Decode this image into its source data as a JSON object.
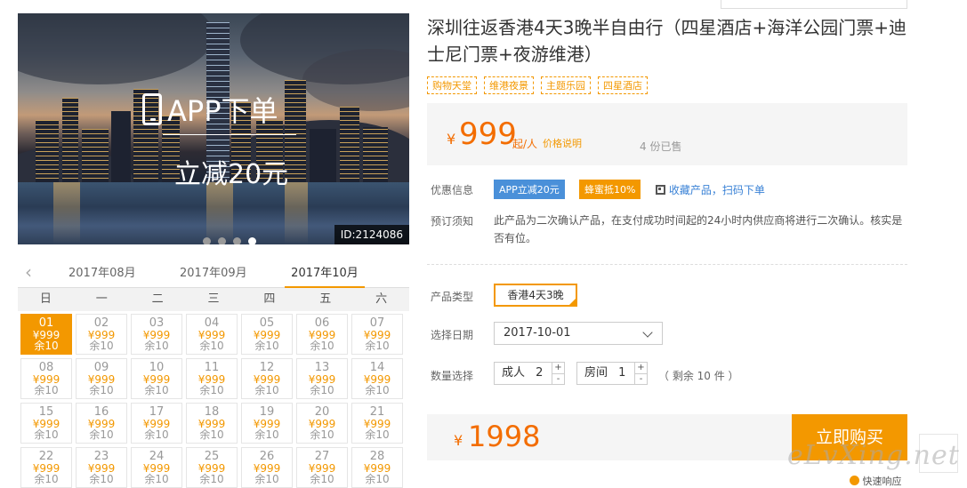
{
  "hero": {
    "promo_line1": "APP下单",
    "promo_line2": "立减20元",
    "id_tag": "ID:2124086",
    "carousel_count": 4,
    "carousel_active": 4
  },
  "calendar": {
    "months": [
      "2017年08月",
      "2017年09月",
      "2017年10月"
    ],
    "active_month": "2017年10月",
    "weekdays": [
      "日",
      "一",
      "二",
      "三",
      "四",
      "五",
      "六"
    ],
    "days": [
      {
        "day": "01",
        "price": "¥999",
        "stock": "余10",
        "selected": true
      },
      {
        "day": "02",
        "price": "¥999",
        "stock": "余10"
      },
      {
        "day": "03",
        "price": "¥999",
        "stock": "余10"
      },
      {
        "day": "04",
        "price": "¥999",
        "stock": "余10"
      },
      {
        "day": "05",
        "price": "¥999",
        "stock": "余10"
      },
      {
        "day": "06",
        "price": "¥999",
        "stock": "余10"
      },
      {
        "day": "07",
        "price": "¥999",
        "stock": "余10"
      },
      {
        "day": "08",
        "price": "¥999",
        "stock": "余10"
      },
      {
        "day": "09",
        "price": "¥999",
        "stock": "余10"
      },
      {
        "day": "10",
        "price": "¥999",
        "stock": "余10"
      },
      {
        "day": "11",
        "price": "¥999",
        "stock": "余10"
      },
      {
        "day": "12",
        "price": "¥999",
        "stock": "余10"
      },
      {
        "day": "13",
        "price": "¥999",
        "stock": "余10"
      },
      {
        "day": "14",
        "price": "¥999",
        "stock": "余10"
      },
      {
        "day": "15",
        "price": "¥999",
        "stock": "余10"
      },
      {
        "day": "16",
        "price": "¥999",
        "stock": "余10"
      },
      {
        "day": "17",
        "price": "¥999",
        "stock": "余10"
      },
      {
        "day": "18",
        "price": "¥999",
        "stock": "余10"
      },
      {
        "day": "19",
        "price": "¥999",
        "stock": "余10"
      },
      {
        "day": "20",
        "price": "¥999",
        "stock": "余10"
      },
      {
        "day": "21",
        "price": "¥999",
        "stock": "余10"
      },
      {
        "day": "22",
        "price": "¥999",
        "stock": "余10"
      },
      {
        "day": "23",
        "price": "¥999",
        "stock": "余10"
      },
      {
        "day": "24",
        "price": "¥999",
        "stock": "余10"
      },
      {
        "day": "25",
        "price": "¥999",
        "stock": "余10"
      },
      {
        "day": "26",
        "price": "¥999",
        "stock": "余10"
      },
      {
        "day": "27",
        "price": "¥999",
        "stock": "余10"
      },
      {
        "day": "28",
        "price": "¥999",
        "stock": "余10"
      }
    ]
  },
  "product": {
    "title": "深圳往返香港4天3晚半自由行（四星酒店+海洋公园门票+迪士尼门票+夜游维港）",
    "tags": [
      "购物天堂",
      "维港夜景",
      "主题乐园",
      "四星酒店"
    ],
    "currency": "¥",
    "price": "999",
    "price_unit": "起/人",
    "price_note": "价格说明",
    "sold": "4 份已售",
    "offers_label": "优惠信息",
    "offer_app": "APP立减20元",
    "offer_honey": "蜂蜜抵10%",
    "favorite_link": "收藏产品，扫码下单",
    "booking_label": "预订须知",
    "booking_text": "此产品为二次确认产品，在支付成功时间起的24小时内供应商将进行二次确认。核实是否有位。",
    "type_label": "产品类型",
    "type_value": "香港4天3晚",
    "date_label": "选择日期",
    "date_value": "2017-10-01",
    "qty_label": "数量选择",
    "adult_label": "成人",
    "adult_qty": "2",
    "room_label": "房间",
    "room_qty": "1",
    "remaining": "（ 剩余 10 件 ）",
    "plus": "+",
    "minus": "-",
    "total_currency": "¥",
    "total": "1998",
    "buy_label": "立即购买",
    "fast_response": "快速响应"
  },
  "watermark": "eLvXing.net",
  "colors": {
    "accent": "#f39800",
    "price": "#f36d00",
    "app_badge": "#4a90d9"
  }
}
